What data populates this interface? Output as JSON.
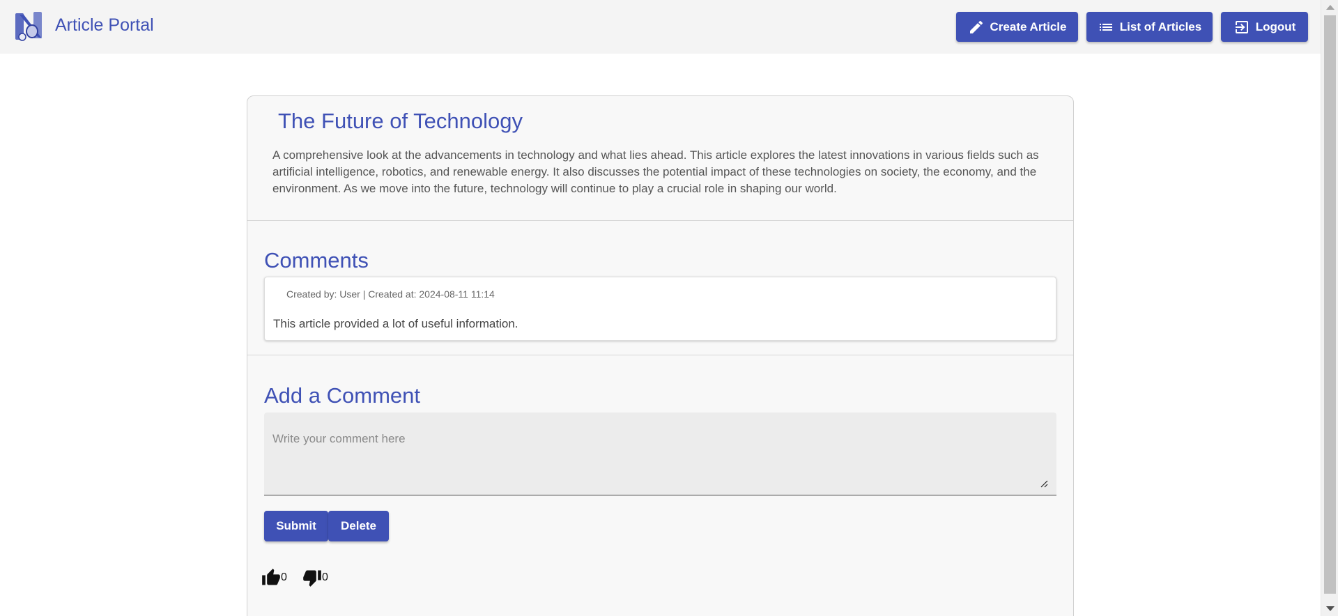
{
  "header": {
    "brand": "Article Portal",
    "logo_icon": "scroll-logo-icon",
    "buttons": {
      "create": "Create Article",
      "list": "List of Articles",
      "logout": "Logout"
    }
  },
  "article": {
    "title": "The Future of Technology",
    "body": "A comprehensive look at the advancements in technology and what lies ahead. This article explores the latest innovations in various fields such as artificial intelligence, robotics, and renewable energy. It also discusses the potential impact of these technologies on society, the economy, and the environment. As we move into the future, technology will continue to play a crucial role in shaping our world."
  },
  "comments": {
    "title": "Comments",
    "items": [
      {
        "meta": "Created by: User | Created at: 2024-08-11 11:14",
        "text": "This article provided a lot of useful information."
      }
    ]
  },
  "add_comment": {
    "title": "Add a Comment",
    "placeholder": "Write your comment here",
    "submit_label": "Submit",
    "delete_label": "Delete"
  },
  "votes": {
    "likes": "0",
    "dislikes": "0"
  },
  "colors": {
    "accent": "#3f51b5",
    "header_bg": "#f4f4f4",
    "card_bg": "#f8f8f8"
  }
}
